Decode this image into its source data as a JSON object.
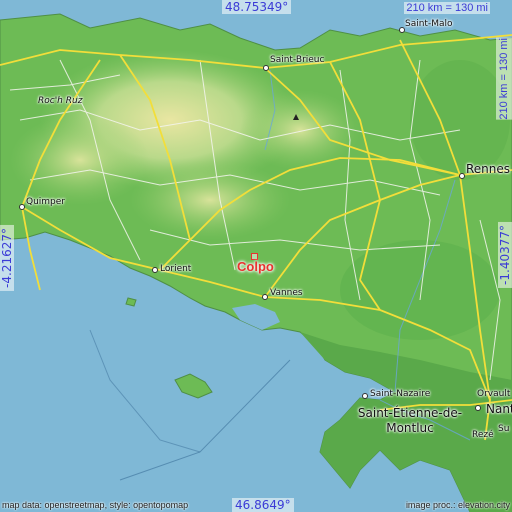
{
  "place": {
    "name": "Colpo"
  },
  "coordinates": {
    "top": "48.75349°",
    "bottom": "46.8649°",
    "left": "-4.21627°",
    "right": "-1.40377°"
  },
  "scale": {
    "horizontal": "210 km = 130 mi",
    "vertical": "210 km = 130 mi"
  },
  "cities": [
    {
      "name": "Saint-Malo"
    },
    {
      "name": "Saint-Brieuc"
    },
    {
      "name": "Roc'h Ruz"
    },
    {
      "name": "Rennes"
    },
    {
      "name": "Quimper"
    },
    {
      "name": "Lorient"
    },
    {
      "name": "Vannes"
    },
    {
      "name": "Saint-Nazaire"
    },
    {
      "name": "Saint-Étienne-de-Montluc"
    },
    {
      "name": "Orvault"
    },
    {
      "name": "Nant"
    },
    {
      "name": "Rezé"
    },
    {
      "name": "Su"
    }
  ],
  "credits": {
    "left": "map data: openstreetmap, style: opentopomap",
    "right": "image proc.: elevation.city"
  },
  "icons": {
    "target": "red-square-marker",
    "peak": "triangle-peak-icon"
  },
  "colors": {
    "sea": "#7fb8d6",
    "land": "#6cbf5a",
    "road": "#f2de3a",
    "target": "#e8322f",
    "coord": "#3b3bd6"
  }
}
